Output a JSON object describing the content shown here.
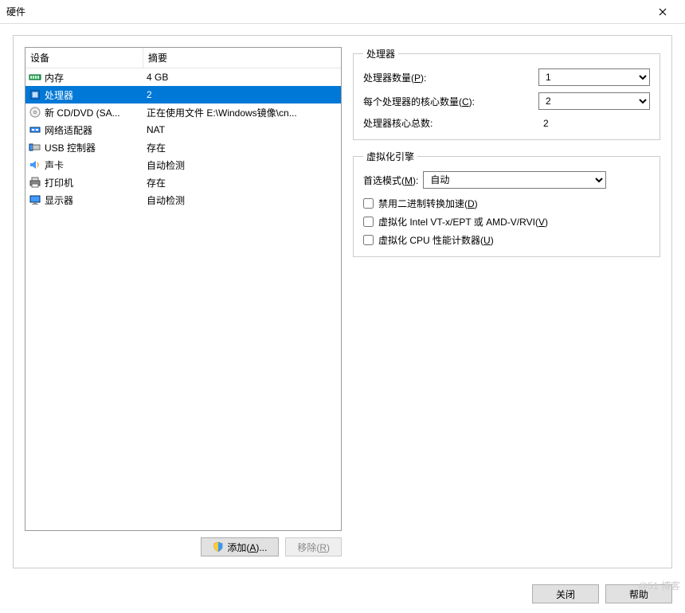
{
  "title": "硬件",
  "columns": {
    "device": "设备",
    "summary": "摘要"
  },
  "hardware": [
    {
      "icon": "memory-icon",
      "name": "内存",
      "summary": "4 GB"
    },
    {
      "icon": "cpu-icon",
      "name": "处理器",
      "summary": "2",
      "selected": true
    },
    {
      "icon": "cd-icon",
      "name": "新 CD/DVD (SA...",
      "summary": "正在使用文件 E:\\Windows镜像\\cn..."
    },
    {
      "icon": "network-icon",
      "name": "网络适配器",
      "summary": "NAT"
    },
    {
      "icon": "usb-icon",
      "name": "USB 控制器",
      "summary": "存在"
    },
    {
      "icon": "sound-icon",
      "name": "声卡",
      "summary": "自动检测"
    },
    {
      "icon": "printer-icon",
      "name": "打印机",
      "summary": "存在"
    },
    {
      "icon": "display-icon",
      "name": "显示器",
      "summary": "自动检测"
    }
  ],
  "buttons": {
    "add_prefix": "添加(",
    "add_hotkey": "A",
    "add_suffix": ")...",
    "remove_prefix": "移除(",
    "remove_hotkey": "R",
    "remove_suffix": ")",
    "close": "关闭",
    "help": "帮助"
  },
  "proc_group": {
    "legend": "处理器",
    "count_prefix": "处理器数量(",
    "count_hotkey": "P",
    "count_suffix": "):",
    "count_value": "1",
    "cores_prefix": "每个处理器的核心数量(",
    "cores_hotkey": "C",
    "cores_suffix": "):",
    "cores_value": "2",
    "total_label": "处理器核心总数:",
    "total_value": "2"
  },
  "virt_group": {
    "legend": "虚拟化引擎",
    "mode_prefix": "首选模式(",
    "mode_hotkey": "M",
    "mode_suffix": "):",
    "mode_value": "自动",
    "chk1_prefix": "禁用二进制转换加速(",
    "chk1_hotkey": "D",
    "chk1_suffix": ")",
    "chk2_prefix": "虚拟化 Intel VT-x/EPT 或 AMD-V/RVI(",
    "chk2_hotkey": "V",
    "chk2_suffix": ")",
    "chk3_prefix": "虚拟化 CPU 性能计数器(",
    "chk3_hotkey": "U",
    "chk3_suffix": ")"
  },
  "watermark": "@51   博客"
}
